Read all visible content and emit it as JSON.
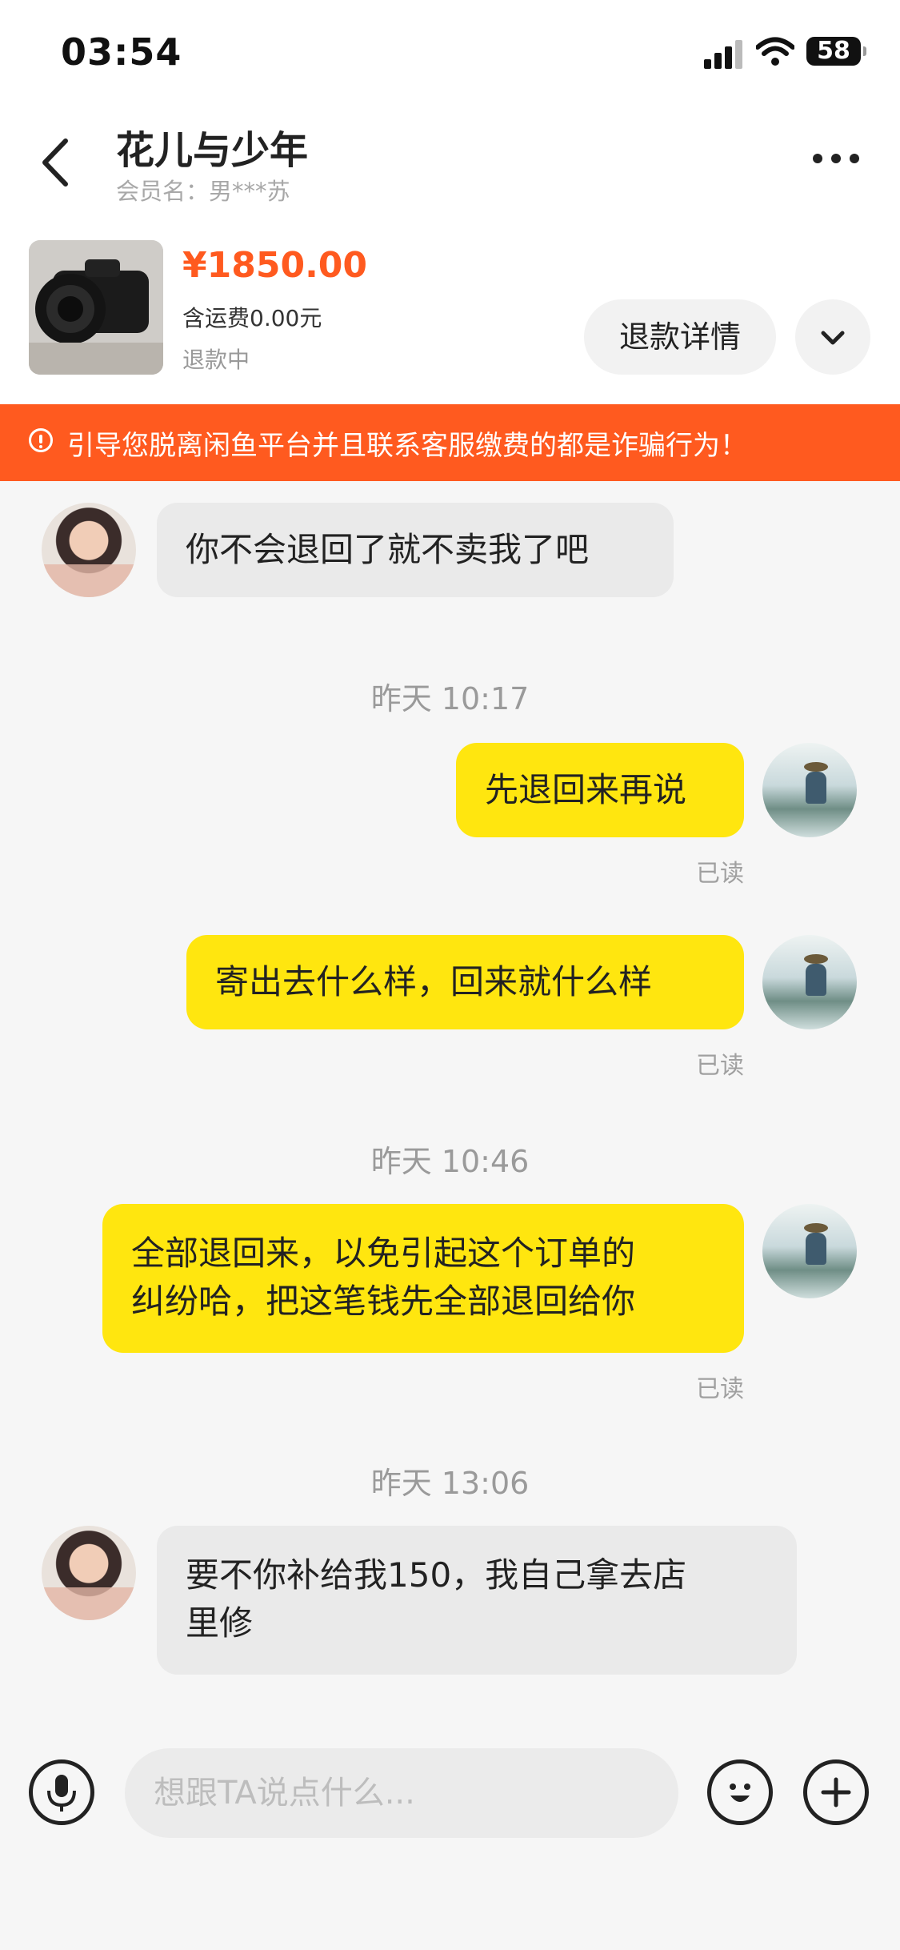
{
  "status_bar": {
    "time": "03:54",
    "battery": "58"
  },
  "header": {
    "contact_name": "花儿与少年",
    "member_label": "会员名：男***苏"
  },
  "product": {
    "price": "¥1850.00",
    "shipping": "含运费0.00元",
    "status": "退款中",
    "refund_button": "退款详情"
  },
  "warning": "引导您脱离闲鱼平台并且联系客服缴费的都是诈骗行为！",
  "messages": [
    {
      "side": "left",
      "text": "你不会退回了就不卖我了吧"
    },
    {
      "timestamp": "昨天 10:17"
    },
    {
      "side": "right",
      "text": "先退回来再说",
      "read": "已读"
    },
    {
      "side": "right",
      "text": "寄出去什么样，回来就什么样",
      "read": "已读"
    },
    {
      "timestamp": "昨天 10:46"
    },
    {
      "side": "right",
      "lines": [
        "全部退回来，以免引起这个订单的",
        "纠纷哈，把这笔钱先全部退回给你"
      ],
      "read": "已读"
    },
    {
      "timestamp": "昨天 13:06"
    },
    {
      "side": "left",
      "lines": [
        "要不你补给我150，我自己拿去店",
        "里修"
      ]
    }
  ],
  "input": {
    "placeholder": "想跟TA说点什么..."
  },
  "icons": [
    "back-arrow-icon",
    "more-icon",
    "chevron-down-icon",
    "warning-icon",
    "microphone-icon",
    "emoji-icon",
    "plus-icon"
  ],
  "colors": {
    "accent": "#ff5a1f",
    "bubble_self": "#ffe60f",
    "bubble_other": "#eaeaea"
  }
}
